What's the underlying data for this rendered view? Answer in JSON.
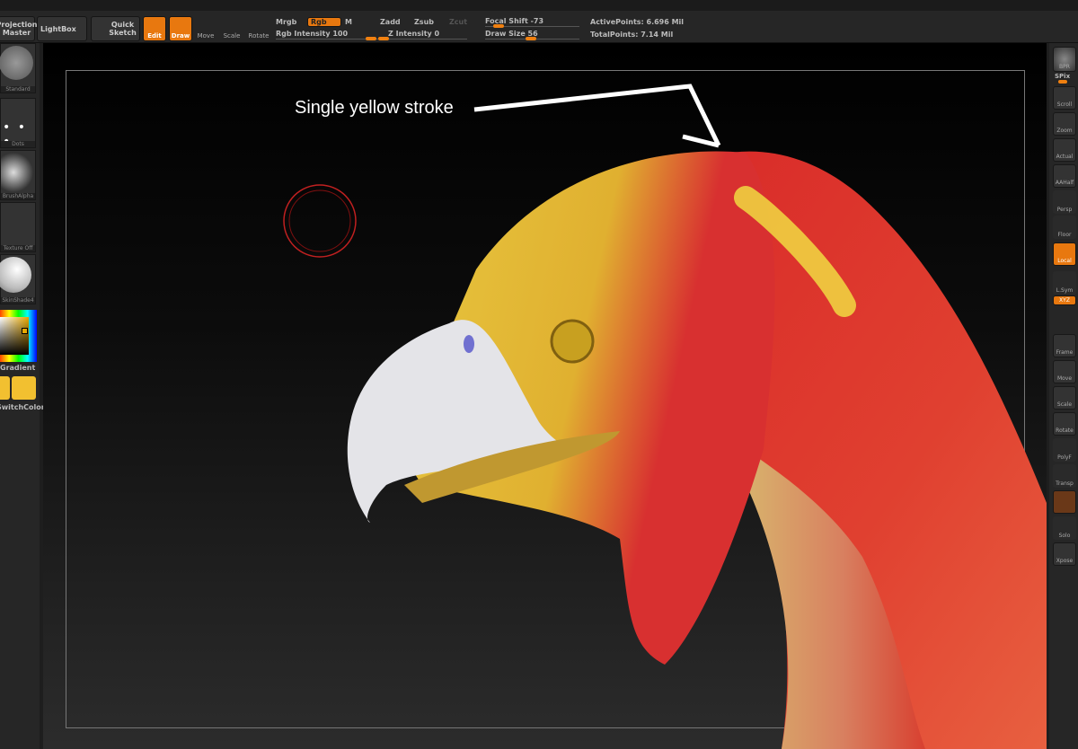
{
  "toolbar": {
    "projection_master": "Projection Master",
    "lightbox": "LightBox",
    "quick_sketch": "Quick Sketch",
    "edit": "Edit",
    "draw": "Draw",
    "move": "Move",
    "scale": "Scale",
    "rotate": "Rotate",
    "mrgb": "Mrgb",
    "rgb": "Rgb",
    "m": "M",
    "zadd": "Zadd",
    "zsub": "Zsub",
    "zcut": "Zcut",
    "rgb_intensity": "Rgb Intensity 100",
    "z_intensity": "Z Intensity 0",
    "focal_shift": "Focal Shift -73",
    "draw_size": "Draw Size 56",
    "active_points": "ActivePoints: 6.696 Mil",
    "total_points": "TotalPoints: 7.14 Mil"
  },
  "left": {
    "brush": "Standard",
    "stroke": "Dots",
    "alpha": "BrushAlpha",
    "texture": "Texture Off",
    "material": "SkinShade4",
    "gradient": "Gradient",
    "switch_color": "SwitchColor"
  },
  "right": [
    "BPR",
    "SPix",
    "Scroll",
    "Zoom",
    "Actual",
    "AAHalf",
    "Persp",
    "Floor",
    "Local",
    "L.Sym",
    "XYZ",
    "Frame",
    "Move",
    "Scale",
    "Rotate",
    "PolyF",
    "Transp",
    "Solo",
    "Xpose"
  ],
  "annotation": "Single yellow stroke",
  "colors": {
    "accent": "#e8780f",
    "main_color": "#f2c030"
  }
}
